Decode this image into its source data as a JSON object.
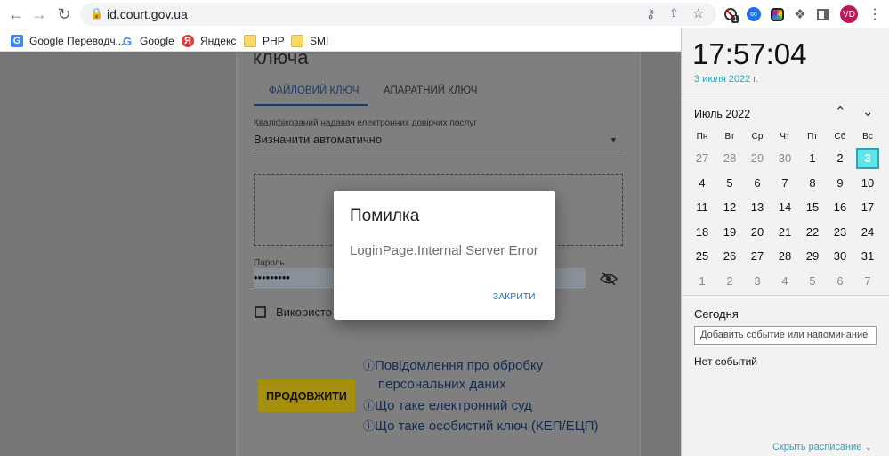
{
  "browser": {
    "url": "id.court.gov.ua",
    "profile_initials": "VD",
    "extension_badge": "1",
    "bookmarks": [
      {
        "label": "Google Переводч...",
        "icon": "google-translate-icon"
      },
      {
        "label": "Google",
        "icon": "google-icon"
      },
      {
        "label": "Яндекс",
        "icon": "yandex-icon"
      },
      {
        "label": "PHP",
        "icon": "folder-icon"
      },
      {
        "label": "SMI",
        "icon": "folder-icon"
      }
    ]
  },
  "page": {
    "heading_partial": "ключа",
    "tabs": [
      "ФАЙЛОВИЙ КЛЮЧ",
      "АПАРАТНИЙ КЛЮЧ"
    ],
    "provider_label": "Кваліфікований надавач електронних довірчих послуг",
    "provider_value": "Визначити автоматично",
    "password_label": "Пароль",
    "password_value": "•••••••••",
    "checkbox_label": "Використо",
    "continue_button": "ПРОДОВЖИТИ",
    "links": [
      "Повідомлення про обробку",
      "персональних даних",
      "Що таке електронний суд",
      "Що таке особистий ключ (КЕП/ЕЦП)"
    ]
  },
  "dialog": {
    "title": "Помилка",
    "message": "LoginPage.Internal Server Error",
    "close_button": "ЗАКРИТИ"
  },
  "calendar": {
    "time": "17:57:04",
    "date": "3 июля 2022 г.",
    "month": "Июль 2022",
    "weekdays": [
      "Пн",
      "Вт",
      "Ср",
      "Чт",
      "Пт",
      "Сб",
      "Вс"
    ],
    "weeks": [
      [
        "27",
        "28",
        "29",
        "30",
        "1",
        "2",
        "3"
      ],
      [
        "4",
        "5",
        "6",
        "7",
        "8",
        "9",
        "10"
      ],
      [
        "11",
        "12",
        "13",
        "14",
        "15",
        "16",
        "17"
      ],
      [
        "18",
        "19",
        "20",
        "21",
        "22",
        "23",
        "24"
      ],
      [
        "25",
        "26",
        "27",
        "28",
        "29",
        "30",
        "31"
      ],
      [
        "1",
        "2",
        "3",
        "4",
        "5",
        "6",
        "7"
      ]
    ],
    "today_heading": "Сегодня",
    "add_event_placeholder": "Добавить событие или напоминание",
    "no_events": "Нет событий",
    "hide_schedule": "Скрыть расписание"
  },
  "colors": {
    "accent": "#2f6aa7",
    "button_yellow": "#d4b200",
    "today_cell": "#5ee6e6",
    "calendar_date": "#2aa6b8"
  }
}
